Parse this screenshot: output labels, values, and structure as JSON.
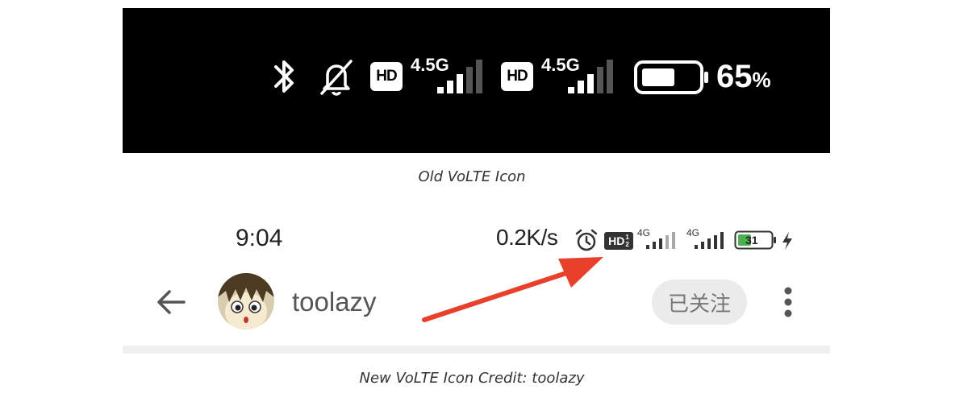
{
  "figure1": {
    "network_label_1": "4.5G",
    "network_label_2": "4.5G",
    "hd_badge_1": "HD",
    "hd_badge_2": "HD",
    "battery_percent": "65",
    "battery_symbol": "%",
    "battery_level": 0.65,
    "icons": [
      "bluetooth-icon",
      "bell-off-icon",
      "signal-icon",
      "battery-icon"
    ]
  },
  "captions": {
    "first": "Old VoLTE Icon",
    "second": "New VoLTE Icon Credit: toolazy"
  },
  "figure2": {
    "status": {
      "time": "9:04",
      "speed": "0.2K/s",
      "hd_badge": "HD",
      "hd_sub": "1",
      "hd_sub2": "2",
      "net_1": "4G",
      "net_2": "4G",
      "battery": "31",
      "icons": [
        "alarm-icon",
        "signal-icon",
        "battery-icon",
        "charging-icon"
      ]
    },
    "header": {
      "username": "toolazy",
      "follow_label": "已关注",
      "icons": [
        "back-arrow-icon",
        "more-vert-icon"
      ]
    },
    "annotation": {
      "arrow_color": "#e8402a"
    }
  }
}
